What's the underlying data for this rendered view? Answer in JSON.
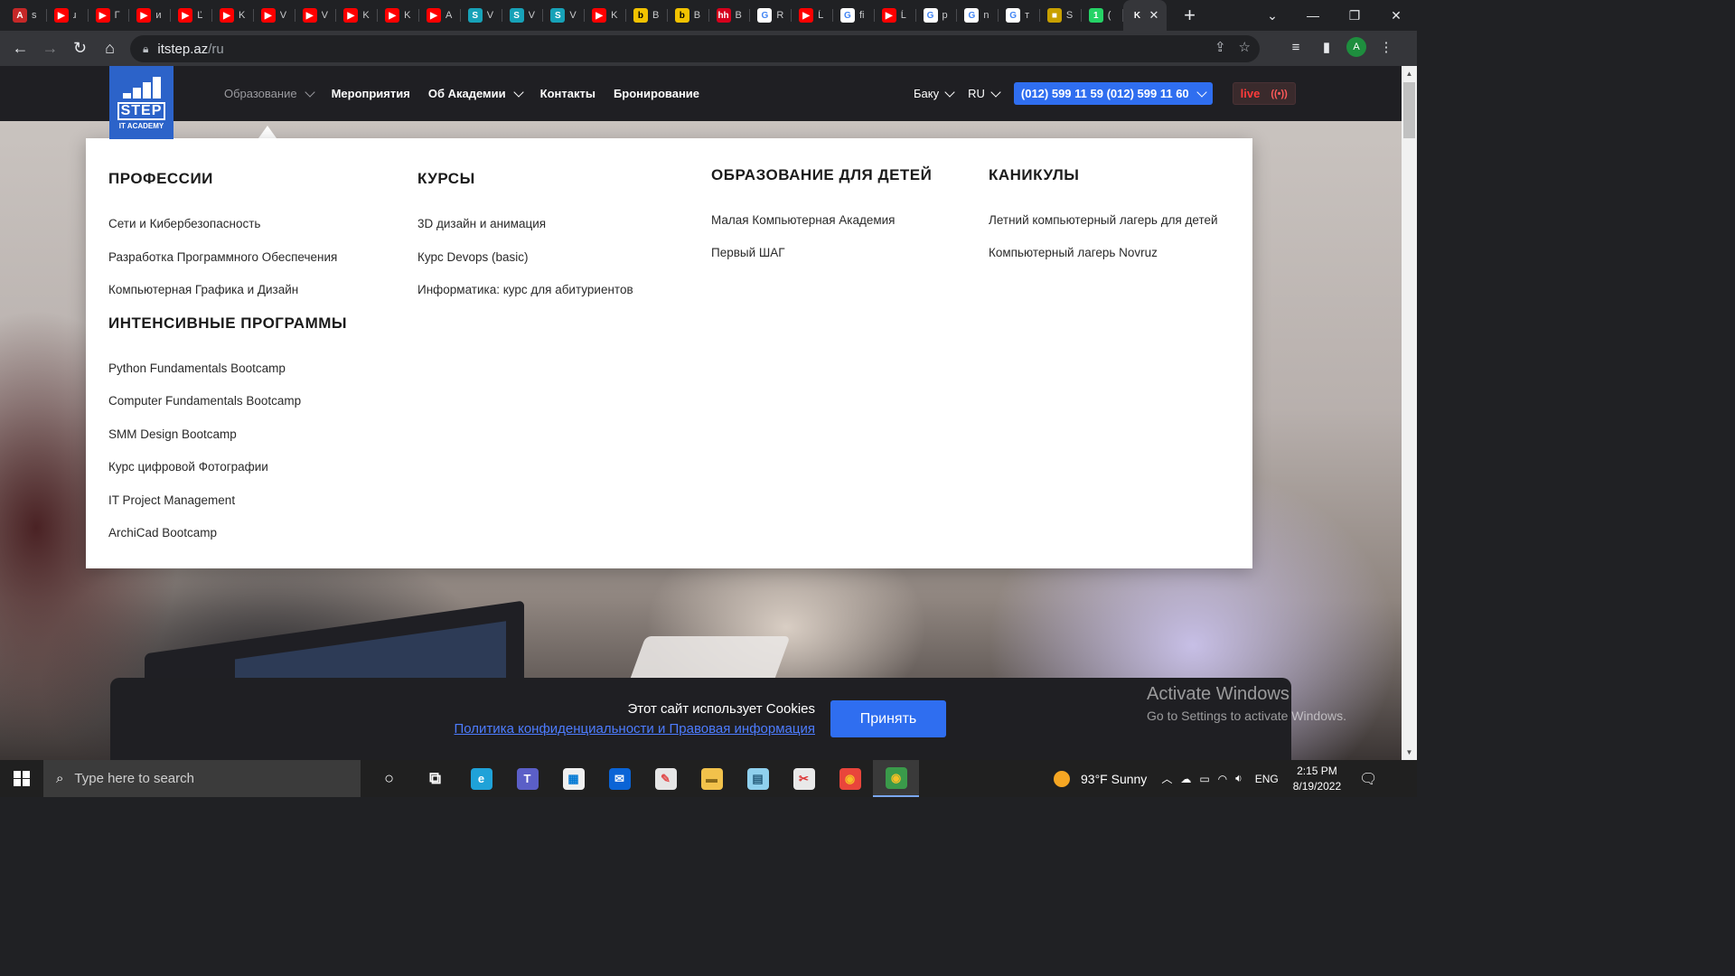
{
  "browser": {
    "tabs": [
      {
        "fav": "A",
        "color": "#c62828",
        "title": "s"
      },
      {
        "fav": "▶",
        "color": "#ff0000",
        "title": "ɹ"
      },
      {
        "fav": "▶",
        "color": "#ff0000",
        "title": "Г"
      },
      {
        "fav": "▶",
        "color": "#ff0000",
        "title": "и"
      },
      {
        "fav": "▶",
        "color": "#ff0000",
        "title": "Ľ"
      },
      {
        "fav": "▶",
        "color": "#ff0000",
        "title": "K"
      },
      {
        "fav": "▶",
        "color": "#ff0000",
        "title": "V"
      },
      {
        "fav": "▶",
        "color": "#ff0000",
        "title": "V"
      },
      {
        "fav": "▶",
        "color": "#ff0000",
        "title": "K"
      },
      {
        "fav": "▶",
        "color": "#ff0000",
        "title": "K"
      },
      {
        "fav": "▶",
        "color": "#ff0000",
        "title": "A"
      },
      {
        "fav": "S",
        "color": "#17a2b8",
        "title": "V"
      },
      {
        "fav": "S",
        "color": "#17a2b8",
        "title": "V"
      },
      {
        "fav": "S",
        "color": "#17a2b8",
        "title": "V"
      },
      {
        "fav": "▶",
        "color": "#ff0000",
        "title": "K"
      },
      {
        "fav": "b",
        "color": "#f2c200",
        "title": "B"
      },
      {
        "fav": "b",
        "color": "#f2c200",
        "title": "B"
      },
      {
        "fav": "hh",
        "color": "#d6001c",
        "title": "B"
      },
      {
        "fav": "G",
        "color": "#ffffff",
        "title": "R"
      },
      {
        "fav": "▶",
        "color": "#ff0000",
        "title": "Ĺ"
      },
      {
        "fav": "G",
        "color": "#ffffff",
        "title": "fi"
      },
      {
        "fav": "▶",
        "color": "#ff0000",
        "title": "Ĺ"
      },
      {
        "fav": "G",
        "color": "#ffffff",
        "title": "p"
      },
      {
        "fav": "G",
        "color": "#ffffff",
        "title": "n"
      },
      {
        "fav": "G",
        "color": "#ffffff",
        "title": "т"
      },
      {
        "fav": "■",
        "color": "#c8a000",
        "title": "S"
      },
      {
        "fav": "1",
        "color": "#25d366",
        "title": "("
      },
      {
        "fav": "K",
        "color": "#35363a",
        "title": ""
      }
    ],
    "new_tab": "+",
    "url_host": "itstep.az",
    "url_path": "/ru",
    "profile_initial": "A"
  },
  "site": {
    "logo": {
      "word": "STEP",
      "sub": "IT ACADEMY"
    },
    "nav": [
      {
        "label": "Образование",
        "dropdown": true,
        "dim": true
      },
      {
        "label": "Мероприятия",
        "dropdown": false
      },
      {
        "label": "Об Академии",
        "dropdown": true
      },
      {
        "label": "Контакты",
        "dropdown": false
      },
      {
        "label": "Бронирование",
        "dropdown": false
      }
    ],
    "city": "Баку",
    "lang": "RU",
    "phone": "(012) 599 11 59 (012) 599 11 60",
    "live": "live",
    "live_icon": "((•))"
  },
  "mega_menu": {
    "professions": {
      "title": "ПРОФЕССИИ",
      "links": [
        "Сети и Кибербезопасность",
        "Разработка Программного Обеспечения",
        "Компьютерная Графика и Дизайн"
      ]
    },
    "intensive": {
      "title": "ИНТЕНСИВНЫЕ ПРОГРАММЫ",
      "links": [
        "Python Fundamentals Bootcamp",
        "Computer Fundamentals Bootcamp",
        "SMM Design Bootcamp",
        "Курс цифровой Фотографии",
        "IT Project Management",
        "ArchiCad Bootcamp"
      ]
    },
    "courses": {
      "title": "КУРСЫ",
      "links": [
        "3D дизайн и анимация",
        "Курс Devops (basic)",
        "Информатика: курс для абитуриентов"
      ]
    },
    "kids": {
      "title": "ОБРАЗОВАНИЕ ДЛЯ ДЕТЕЙ",
      "links": [
        "Малая Компьютерная Академия",
        "Первый ШАГ"
      ]
    },
    "holidays": {
      "title": "КАНИКУЛЫ",
      "links": [
        "Летний компьютерный лагерь для детей",
        "Компьютерный лагерь Novruz"
      ]
    }
  },
  "cookie": {
    "message": "Этот сайт использует Cookies",
    "policy": "Политика конфиденциальности и Правовая информация",
    "accept": "Принять"
  },
  "watermark": {
    "line1": "Activate Windows",
    "line2": "Go to Settings to activate Windows."
  },
  "taskbar": {
    "search_placeholder": "Type here to search",
    "apps": [
      "cortana-icon",
      "task-view-icon",
      "edge-icon",
      "teams-icon",
      "store-icon",
      "mail-icon",
      "paint-icon",
      "file-explorer-icon",
      "notepad-icon",
      "snip-icon",
      "chrome-icon",
      "chrome-profile-icon"
    ],
    "weather": "93°F  Sunny",
    "language": "ENG",
    "time": "2:15 PM",
    "date": "8/19/2022"
  }
}
